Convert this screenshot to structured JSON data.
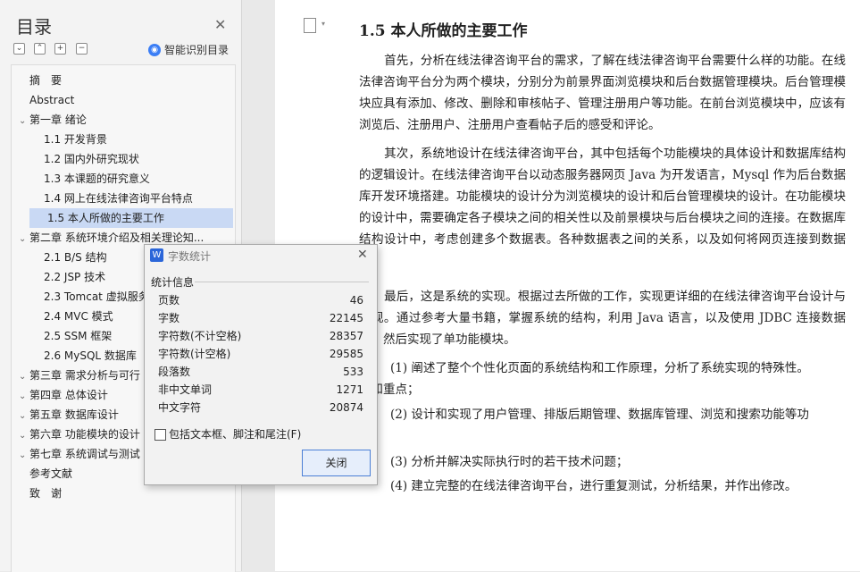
{
  "nav": {
    "title": "目录",
    "smart_label": "智能识别目录",
    "smart_icon": "ai-icon",
    "items": [
      {
        "label": "摘　要",
        "level": 1,
        "caret": false
      },
      {
        "label": "Abstract",
        "level": 1,
        "caret": false
      },
      {
        "label": "第一章  绪论",
        "level": 1,
        "caret": true
      },
      {
        "label": "1.1  开发背景",
        "level": 2,
        "caret": false
      },
      {
        "label": "1.2  国内外研究现状",
        "level": 2,
        "caret": false
      },
      {
        "label": "1.3  本课题的研究意义",
        "level": 2,
        "caret": false
      },
      {
        "label": "1.4  网上在线法律咨询平台特点",
        "level": 2,
        "caret": false
      },
      {
        "label": "1.5  本人所做的主要工作",
        "level": 2,
        "caret": false,
        "selected": true
      },
      {
        "label": "第二章  系统环境介绍及相关理论知...",
        "level": 1,
        "caret": true
      },
      {
        "label": "2.1 B/S 结构",
        "level": 2,
        "caret": false
      },
      {
        "label": "2.2 JSP 技术",
        "level": 2,
        "caret": false
      },
      {
        "label": "2.3 Tomcat 虚拟服务",
        "level": 2,
        "caret": false
      },
      {
        "label": "2.4 MVC 模式",
        "level": 2,
        "caret": false
      },
      {
        "label": "2.5 SSM 框架",
        "level": 2,
        "caret": false
      },
      {
        "label": "2.6 MySQL 数据库",
        "level": 2,
        "caret": false
      },
      {
        "label": "第三章  需求分析与可行",
        "level": 1,
        "caret": true
      },
      {
        "label": "第四章  总体设计",
        "level": 1,
        "caret": true
      },
      {
        "label": "第五章  数据库设计",
        "level": 1,
        "caret": true
      },
      {
        "label": "第六章  功能模块的设计",
        "level": 1,
        "caret": true
      },
      {
        "label": "第七章  系统调试与测试",
        "level": 1,
        "caret": true
      },
      {
        "label": "参考文献",
        "level": 1,
        "caret": false
      },
      {
        "label": "致　谢",
        "level": 1,
        "caret": false
      }
    ]
  },
  "document": {
    "heading": "1.5  本人所做的主要工作",
    "paragraphs": [
      "首先，分析在线法律咨询平台的需求，了解在线法律咨询平台需要什么样的功能。在线法律咨询平台分为两个模块，分别分为前景界面浏览模块和后台数据管理模块。后台管理模块应具有添加、修改、删除和审核帖子、管理注册用户等功能。在前台浏览模块中，应该有浏览后、注册用户、注册用户查看帖子后的感受和评论。",
      "其次，系统地设计在线法律咨询平台，其中包括每个功能模块的具体设计和数据库结构的逻辑设计。在线法律咨询平台以动态服务器网页 Java 为开发语言，Mysql 作为后台数据库开发环境搭建。功能模块的设计分为浏览模块的设计和后台管理模块的设计。在功能模块的设计中，需要确定各子模块之间的相关性以及前景模块与后台模块之间的连接。在数据库结构设计中，考虑创建多个数据表。各种数据表之间的关系，以及如何将网页连接到数据库。",
      "最后，这是系统的实现。根据过去所做的工作，实现更详细的在线法律咨询平台设计与实现。通过参考大量书籍，掌握系统的结构，利用 Java 语言，以及使用 JDBC 连接数据库。然后实现了单功能模块。"
    ],
    "items": [
      "(1)  阐述了整个个性化页面的系统结构和工作原理，分析了系统实现的特殊性。",
      "点和重点；",
      "(2)  设计和实现了用户管理、排版后期管理、数据库管理、浏览和搜索功能等功",
      "(3)  分析并解决实际执行时的若干技术问题；",
      "(4)  建立完整的在线法律咨询平台，进行重复测试，分析结果，并作出修改。"
    ]
  },
  "dialog": {
    "title": "字数统计",
    "icon_text": "W",
    "section": "统计信息",
    "stats": [
      {
        "label": "页数",
        "value": "46"
      },
      {
        "label": "字数",
        "value": "22145"
      },
      {
        "label": "字符数(不计空格)",
        "value": "28357"
      },
      {
        "label": "字符数(计空格)",
        "value": "29585"
      },
      {
        "label": "段落数",
        "value": "533"
      },
      {
        "label": "非中文单词",
        "value": "1271"
      },
      {
        "label": "中文字符",
        "value": "20874"
      }
    ],
    "checkbox_label": "包括文本框、脚注和尾注(F)",
    "checkbox_checked": false,
    "close_label": "关闭"
  }
}
